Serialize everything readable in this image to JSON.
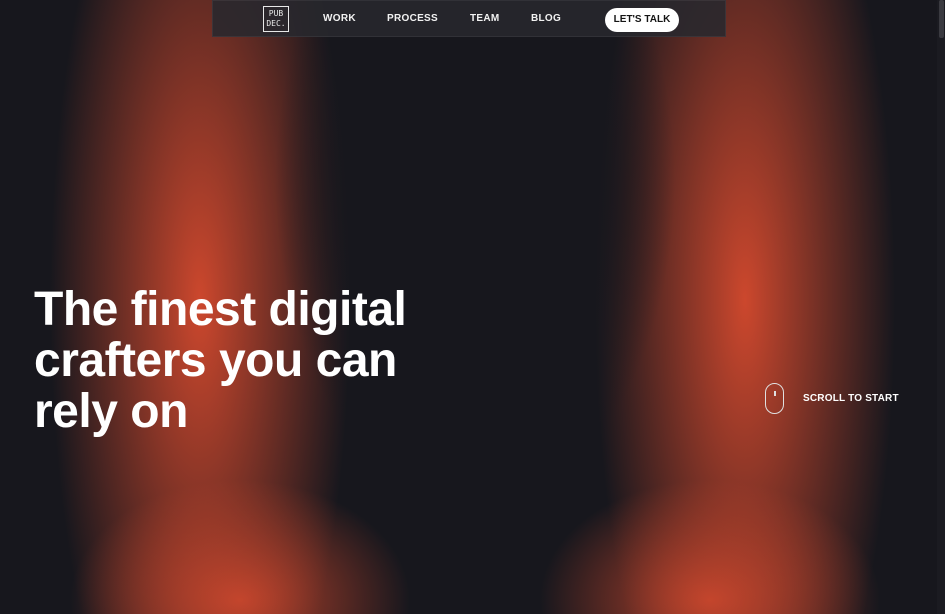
{
  "nav": {
    "logo_line1": "PUB",
    "logo_line2": "DEC.",
    "links": [
      "WORK",
      "PROCESS",
      "TEAM",
      "BLOG"
    ],
    "cta_label": "LET'S TALK"
  },
  "hero": {
    "headline_line1": "The finest digital",
    "headline_line2": "crafters you can",
    "headline_line3": "rely on"
  },
  "scroll_hint": {
    "label": "SCROLL TO START"
  },
  "colors": {
    "background": "#17171d",
    "accent_glow": "#d64a2e",
    "text": "#ffffff"
  }
}
